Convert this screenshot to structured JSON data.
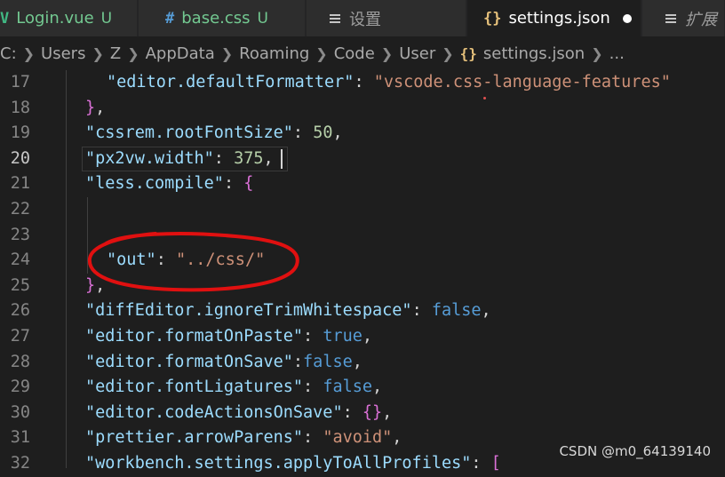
{
  "tabs": [
    {
      "icon": "V",
      "label": "Login.vue",
      "status": "U"
    },
    {
      "icon": "#",
      "label": "base.css",
      "status": "U"
    },
    {
      "icon": "",
      "label": "设置",
      "status": ""
    },
    {
      "icon": "{}",
      "label": "settings.json",
      "status": ""
    },
    {
      "icon": "",
      "label": "扩展",
      "status": ""
    }
  ],
  "breadcrumb": {
    "items": [
      "C:",
      "Users",
      "Z",
      "AppData",
      "Roaming",
      "Code",
      "User"
    ],
    "file_icon": "{}",
    "file": "settings.json",
    "ellipsis": "..."
  },
  "editor": {
    "lines": [
      {
        "n": "17",
        "parts": [
          [
            "key",
            "\"editor.defaultFormatter\""
          ],
          [
            "pun",
            ": "
          ],
          [
            "str",
            "\"vscode.css-language-features\""
          ]
        ]
      },
      {
        "n": "18",
        "parts": [
          [
            "brace",
            "}"
          ],
          [
            "pun",
            ","
          ]
        ]
      },
      {
        "n": "19",
        "parts": [
          [
            "key",
            "\"cssrem.rootFontSize\""
          ],
          [
            "pun",
            ": "
          ],
          [
            "num",
            "50"
          ],
          [
            "pun",
            ","
          ]
        ]
      },
      {
        "n": "20",
        "parts": [
          [
            "key",
            "\"px2vw.width\""
          ],
          [
            "pun",
            ": "
          ],
          [
            "num",
            "375"
          ],
          [
            "pun",
            ","
          ]
        ]
      },
      {
        "n": "21",
        "parts": [
          [
            "key",
            "\"less.compile\""
          ],
          [
            "pun",
            ": "
          ],
          [
            "brace",
            "{"
          ]
        ]
      },
      {
        "n": "22",
        "parts": []
      },
      {
        "n": "23",
        "parts": []
      },
      {
        "n": "24",
        "parts": [
          [
            "key",
            "\"out\""
          ],
          [
            "pun",
            ": "
          ],
          [
            "str",
            "\"../css/\""
          ]
        ]
      },
      {
        "n": "25",
        "parts": [
          [
            "brace",
            "}"
          ],
          [
            "pun",
            ","
          ]
        ]
      },
      {
        "n": "26",
        "parts": [
          [
            "key",
            "\"diffEditor.ignoreTrimWhitespace\""
          ],
          [
            "pun",
            ": "
          ],
          [
            "kw",
            "false"
          ],
          [
            "pun",
            ","
          ]
        ]
      },
      {
        "n": "27",
        "parts": [
          [
            "key",
            "\"editor.formatOnPaste\""
          ],
          [
            "pun",
            ": "
          ],
          [
            "kw",
            "true"
          ],
          [
            "pun",
            ","
          ]
        ]
      },
      {
        "n": "28",
        "parts": [
          [
            "key",
            "\"editor.formatOnSave\""
          ],
          [
            "pun",
            ":"
          ],
          [
            "kw",
            "false"
          ],
          [
            "pun",
            ","
          ]
        ]
      },
      {
        "n": "29",
        "parts": [
          [
            "key",
            "\"editor.fontLigatures\""
          ],
          [
            "pun",
            ": "
          ],
          [
            "kw",
            "false"
          ],
          [
            "pun",
            ","
          ]
        ]
      },
      {
        "n": "30",
        "parts": [
          [
            "key",
            "\"editor.codeActionsOnSave\""
          ],
          [
            "pun",
            ": "
          ],
          [
            "brace",
            "{}"
          ],
          [
            "pun",
            ","
          ]
        ]
      },
      {
        "n": "31",
        "parts": [
          [
            "key",
            "\"prettier.arrowParens\""
          ],
          [
            "pun",
            ": "
          ],
          [
            "str",
            "\"avoid\""
          ],
          [
            "pun",
            ","
          ]
        ]
      },
      {
        "n": "32",
        "parts": [
          [
            "key",
            "\"workbench.settings.applyToAllProfiles\""
          ],
          [
            "pun",
            ": "
          ],
          [
            "brack",
            "["
          ]
        ]
      }
    ],
    "current_line": "20"
  },
  "watermark": "CSDN @m0_64139140",
  "colors": {
    "background": "#1e1e1e",
    "key": "#9cdcfe",
    "string": "#ce9178",
    "number": "#b5cea8",
    "keyword": "#569cd6",
    "brace": "#da70d6",
    "annotation": "#e01010"
  }
}
